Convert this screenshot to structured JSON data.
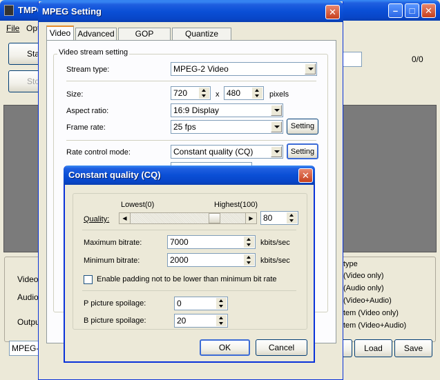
{
  "main_window": {
    "title": "TMPG",
    "menu": [
      "File",
      "Opt"
    ],
    "buttons": [
      "Sta",
      "Sto"
    ],
    "counter": "0/0",
    "side_labels": [
      "Video",
      "Audio",
      "Outpu"
    ],
    "output_type": "MPEG-2",
    "type_header": "type",
    "type_items": [
      "(Video only)",
      "(Audio only)",
      "(Video+Audio)",
      "tem (Video only)",
      "tem (Video+Audio)"
    ],
    "bottom_buttons": {
      "partial": "el",
      "load": "Load",
      "save": "Save"
    }
  },
  "mpeg_dialog": {
    "title": "MPEG Setting",
    "tabs": [
      "Video",
      "Advanced",
      "GOP structure",
      "Quantize matrix"
    ],
    "group_title": "Video stream setting",
    "stream_type_label": "Stream type:",
    "stream_type_value": "MPEG-2 Video",
    "size_label": "Size:",
    "size_width": "720",
    "size_x": "x",
    "size_height": "480",
    "size_unit": "pixels",
    "aspect_label": "Aspect ratio:",
    "aspect_value": "16:9 Display",
    "frame_label": "Frame rate:",
    "frame_value": "25 fps",
    "setting_button": "Setting",
    "rate_label": "Rate control mode:",
    "rate_value": "Constant quality (CQ)"
  },
  "cq_dialog": {
    "title": "Constant quality (CQ)",
    "lowest_label": "Lowest(0)",
    "highest_label": "Highest(100)",
    "quality_label": "Quality:",
    "quality_value": "80",
    "quality_fraction": 0.8,
    "max_label": "Maximum bitrate:",
    "max_value": "7000",
    "min_label": "Minimum bitrate:",
    "min_value": "2000",
    "unit": "kbits/sec",
    "padding_label": "Enable padding not to be lower than minimum bit rate",
    "padding_checked": false,
    "p_label": "P picture spoilage:",
    "p_value": "0",
    "b_label": "B picture spoilage:",
    "b_value": "20",
    "ok_label": "OK",
    "cancel_label": "Cancel"
  }
}
